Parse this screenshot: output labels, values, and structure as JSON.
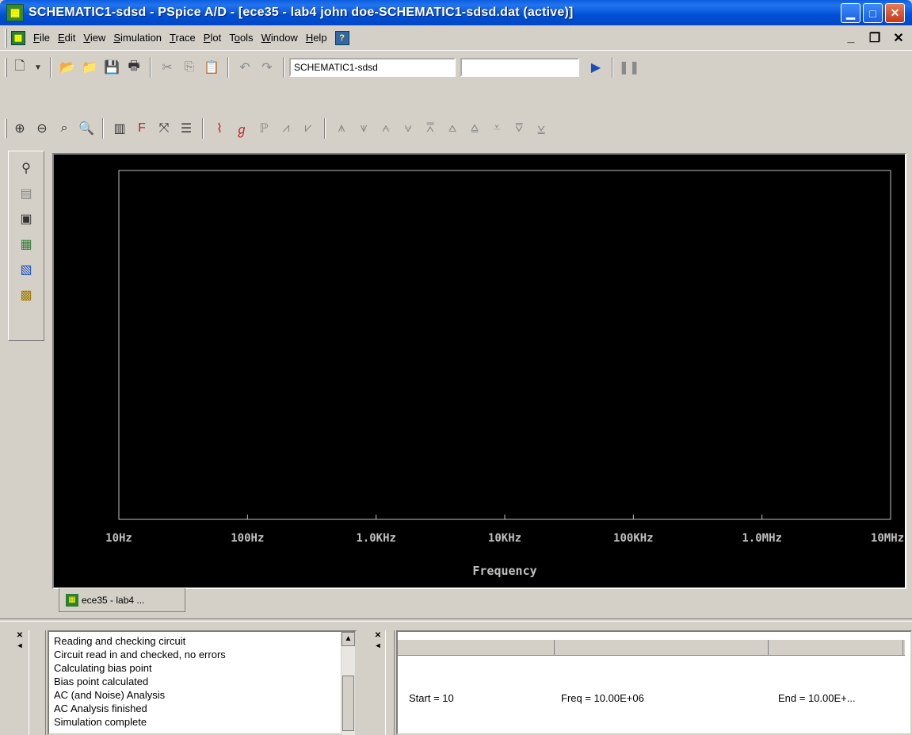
{
  "window": {
    "title": "SCHEMATIC1-sdsd - PSpice A/D  - [ece35 - lab4 john doe-SCHEMATIC1-sdsd.dat (active)]"
  },
  "menu": {
    "items": [
      {
        "key": "file",
        "pre": "",
        "u": "F",
        "post": "ile"
      },
      {
        "key": "edit",
        "pre": "",
        "u": "E",
        "post": "dit"
      },
      {
        "key": "view",
        "pre": "",
        "u": "V",
        "post": "iew"
      },
      {
        "key": "simulation",
        "pre": "",
        "u": "S",
        "post": "imulation"
      },
      {
        "key": "trace",
        "pre": "",
        "u": "T",
        "post": "race"
      },
      {
        "key": "plot",
        "pre": "",
        "u": "P",
        "post": "lot"
      },
      {
        "key": "tools",
        "pre": "T",
        "u": "o",
        "post": "ols"
      },
      {
        "key": "window",
        "pre": "",
        "u": "W",
        "post": "indow"
      },
      {
        "key": "help",
        "pre": "",
        "u": "H",
        "post": "elp"
      }
    ]
  },
  "toolbar": {
    "profile_value": "SCHEMATIC1-sdsd",
    "section_value": ""
  },
  "plot": {
    "x_ticks": [
      "10Hz",
      "100Hz",
      "1.0KHz",
      "10KHz",
      "100KHz",
      "1.0MHz",
      "10MHz"
    ],
    "x_label": "Frequency",
    "background": "#000000",
    "axis_color": "#c0c0c0"
  },
  "tab": {
    "label": "ece35 - lab4 ..."
  },
  "output_log": {
    "lines": [
      "Reading and checking circuit",
      "Circuit read in and checked, no errors",
      "Calculating bias point",
      "Bias point calculated",
      "AC (and Noise) Analysis",
      "AC Analysis finished",
      "Simulation complete"
    ]
  },
  "status": {
    "start": "Start = 10",
    "freq": "Freq = 10.00E+06",
    "end": "End = 10.00E+..."
  }
}
